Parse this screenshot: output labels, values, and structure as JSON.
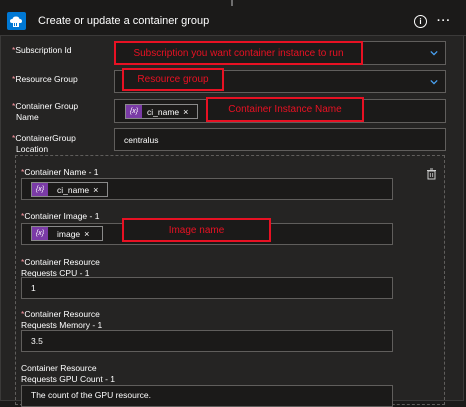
{
  "header": {
    "title": "Create or update a container group",
    "info_label": "i",
    "more_label": "···"
  },
  "fields": {
    "subscription": {
      "label": "Subscription Id",
      "required": "*"
    },
    "resource_group": {
      "label": "Resource Group",
      "required": "*"
    },
    "container_group_name": {
      "label_line1": "Container Group",
      "label_line2": "Name",
      "required": "*",
      "chip": "ci_name"
    },
    "location": {
      "label_line1": "ContainerGroup",
      "label_line2": "Location",
      "required": "*",
      "value": "centralus"
    }
  },
  "group": {
    "container_name": {
      "label": "Container Name - 1",
      "required": "*",
      "chip": "ci_name"
    },
    "container_image": {
      "label": "Container Image - 1",
      "required": "*",
      "chip": "image"
    },
    "cpu": {
      "label_line1": "Container Resource",
      "label_line2": "Requests CPU - 1",
      "required": "*",
      "value": "1"
    },
    "memory": {
      "label_line1": "Container Resource",
      "label_line2": "Requests Memory - 1",
      "required": "*",
      "value": "3.5"
    },
    "gpu": {
      "label_line1": "Container Resource",
      "label_line2": "Requests GPU Count - 1",
      "placeholder": "The count of the GPU resource."
    }
  },
  "annotations": {
    "subscription": "Subscription you want container instance to run",
    "resource_group": "Resource group",
    "instance_name": "Container Instance Name",
    "image_name": "Image name"
  },
  "chip_icon": "{x}",
  "chip_close": "×",
  "colors": {
    "accent": "#0078d4",
    "annotation": "#e81123",
    "chip": "#7a3ba6",
    "required": "#ff99a4"
  }
}
